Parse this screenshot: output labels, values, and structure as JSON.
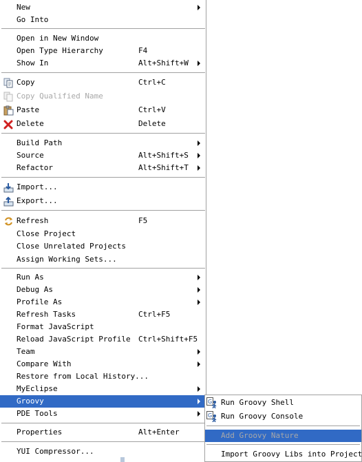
{
  "menu": {
    "items": [
      {
        "id": "new",
        "label": "New",
        "sub": true
      },
      {
        "id": "go-into",
        "label": "Go Into"
      },
      {
        "sep": true
      },
      {
        "id": "open-new-window",
        "label": "Open in New Window"
      },
      {
        "id": "open-type-hierarchy",
        "label": "Open Type Hierarchy",
        "accel": "F4"
      },
      {
        "id": "show-in",
        "label": "Show In",
        "accel": "Alt+Shift+W",
        "sub": true
      },
      {
        "sep": true
      },
      {
        "id": "copy",
        "label": "Copy",
        "accel": "Ctrl+C",
        "icon": "copy-icon"
      },
      {
        "id": "copy-qualified-name",
        "label": "Copy Qualified Name",
        "icon": "copy-icon",
        "disabled": true
      },
      {
        "id": "paste",
        "label": "Paste",
        "accel": "Ctrl+V",
        "icon": "paste-icon"
      },
      {
        "id": "delete",
        "label": "Delete",
        "accel": "Delete",
        "icon": "delete-icon"
      },
      {
        "sep": true
      },
      {
        "id": "build-path",
        "label": "Build Path",
        "sub": true
      },
      {
        "id": "source",
        "label": "Source",
        "accel": "Alt+Shift+S",
        "sub": true
      },
      {
        "id": "refactor",
        "label": "Refactor",
        "accel": "Alt+Shift+T",
        "sub": true
      },
      {
        "sep": true
      },
      {
        "id": "import",
        "label": "Import...",
        "icon": "import-icon"
      },
      {
        "id": "export",
        "label": "Export...",
        "icon": "export-icon"
      },
      {
        "sep": true
      },
      {
        "id": "refresh",
        "label": "Refresh",
        "accel": "F5",
        "icon": "refresh-icon"
      },
      {
        "id": "close-project",
        "label": "Close Project"
      },
      {
        "id": "close-unrelated-projects",
        "label": "Close Unrelated Projects"
      },
      {
        "id": "assign-working-sets",
        "label": "Assign Working Sets..."
      },
      {
        "sep": true
      },
      {
        "id": "run-as",
        "label": "Run As",
        "sub": true
      },
      {
        "id": "debug-as",
        "label": "Debug As",
        "sub": true
      },
      {
        "id": "profile-as",
        "label": "Profile As",
        "sub": true
      },
      {
        "id": "refresh-tasks",
        "label": "Refresh Tasks",
        "accel": "Ctrl+F5"
      },
      {
        "id": "format-javascript",
        "label": "Format JavaScript"
      },
      {
        "id": "reload-javascript-profile",
        "label": "Reload JavaScript Profile",
        "accel": "Ctrl+Shift+F5"
      },
      {
        "id": "team",
        "label": "Team",
        "sub": true
      },
      {
        "id": "compare-with",
        "label": "Compare With",
        "sub": true
      },
      {
        "id": "restore-from-local-history",
        "label": "Restore from Local History..."
      },
      {
        "id": "myeclipse",
        "label": "MyEclipse",
        "sub": true
      },
      {
        "id": "groovy",
        "label": "Groovy",
        "sub": true,
        "highlighted": true
      },
      {
        "id": "pde-tools",
        "label": "PDE Tools",
        "sub": true
      },
      {
        "sep": true
      },
      {
        "id": "properties",
        "label": "Properties",
        "accel": "Alt+Enter"
      },
      {
        "sep": true
      },
      {
        "id": "yui-compressor",
        "label": "YUI Compressor..."
      }
    ]
  },
  "groovy_submenu": {
    "items": [
      {
        "id": "run-groovy-shell",
        "label": "Run Groovy Shell",
        "icon": "groovy-run-icon"
      },
      {
        "id": "run-groovy-console",
        "label": "Run Groovy Console",
        "icon": "groovy-run-icon"
      },
      {
        "sep": true
      },
      {
        "id": "add-groovy-nature",
        "label": "Add Groovy Nature",
        "disabled": true,
        "highlighted": true
      },
      {
        "sep": true
      },
      {
        "id": "import-groovy-libs",
        "label": "Import Groovy Libs into Project"
      }
    ]
  },
  "colors": {
    "highlight": "#316ac5",
    "disabled": "#a8a8a8",
    "separator": "#a0a0a0"
  }
}
